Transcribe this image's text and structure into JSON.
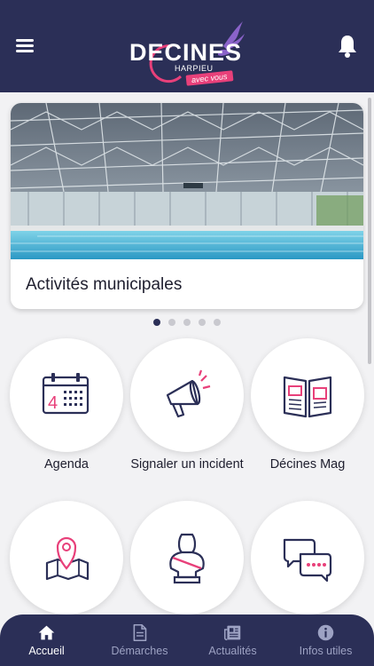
{
  "header": {
    "logo_text": "DECINES",
    "logo_sub": "HARPIEU",
    "logo_tag": "avec vous"
  },
  "carousel": {
    "slides": [
      {
        "title": "Activités municipales"
      }
    ],
    "slide_count": 5,
    "active_index": 0
  },
  "tiles": [
    {
      "label": "Agenda",
      "icon": "calendar-icon"
    },
    {
      "label": "Signaler un incident",
      "icon": "megaphone-icon"
    },
    {
      "label": "Décines Mag",
      "icon": "magazine-icon"
    },
    {
      "label": "",
      "icon": "map-pin-icon"
    },
    {
      "label": "",
      "icon": "bust-icon"
    },
    {
      "label": "",
      "icon": "chat-bubbles-icon"
    }
  ],
  "bottom_nav": [
    {
      "label": "Accueil",
      "icon": "home-icon",
      "active": true
    },
    {
      "label": "Démarches",
      "icon": "document-icon",
      "active": false
    },
    {
      "label": "Actualités",
      "icon": "newspaper-icon",
      "active": false
    },
    {
      "label": "Infos utiles",
      "icon": "info-icon",
      "active": false
    }
  ],
  "colors": {
    "header": "#2b2f57",
    "accent": "#e8407a",
    "icon_navy": "#2b2f57",
    "background": "#f2f2f4"
  }
}
